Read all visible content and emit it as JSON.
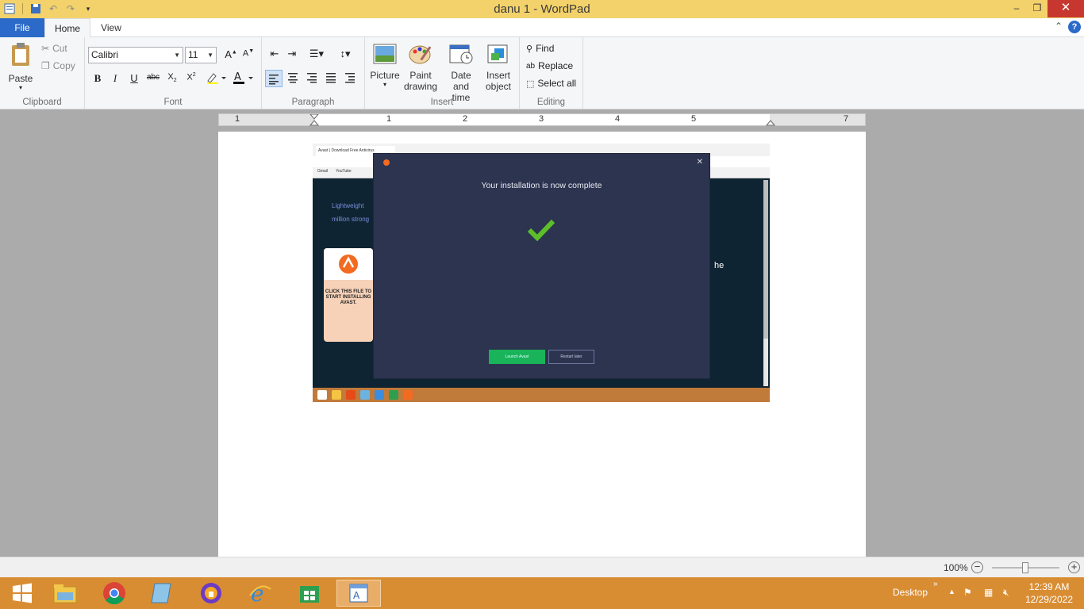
{
  "window": {
    "title": "danu 1 - WordPad",
    "minimize": "–",
    "maximize": "❐",
    "close": "✕"
  },
  "tabs": [
    {
      "label": "File"
    },
    {
      "label": "Home"
    },
    {
      "label": "View"
    }
  ],
  "ribbon": {
    "clipboard": {
      "paste": "Paste",
      "cut": "Cut",
      "copy": "Copy",
      "label": "Clipboard"
    },
    "font": {
      "family": "Calibri",
      "size": "11",
      "label": "Font"
    },
    "paragraph": {
      "label": "Paragraph"
    },
    "insert": {
      "picture": "Picture",
      "paint_1": "Paint",
      "paint_2": "drawing",
      "date_1": "Date and",
      "date_2": "time",
      "object_1": "Insert",
      "object_2": "object",
      "label": "Insert"
    },
    "editing": {
      "find": "Find",
      "replace": "Replace",
      "select_all": "Select all",
      "label": "Editing"
    }
  },
  "ruler": {
    "numbers": [
      "1",
      "1",
      "2",
      "3",
      "4",
      "5",
      "7"
    ]
  },
  "embedded_screenshot": {
    "browser_tab": "Avast | Download Free Antivirus",
    "bookmarks": [
      "Gmail",
      "YouTube"
    ],
    "bg_text_1": "Lightweight",
    "bg_text_2": "million strong",
    "bg_text_3": "he",
    "side_card_text": "CLICK THIS FILE TO START INSTALLING AVAST.",
    "dialog": {
      "heading": "Your installation is now complete",
      "primary_button": "Launch Avast",
      "secondary_button": "Restart later"
    }
  },
  "status": {
    "zoom": "100%",
    "zoom_out": "−",
    "zoom_in": "+"
  },
  "taskbar": {
    "desktop": "Desktop",
    "time": "12:39 AM",
    "date": "12/29/2022"
  },
  "colors": {
    "titlebar": "#f3d26b",
    "file_tab": "#2b6ac8",
    "taskbar": "#d98d33",
    "dialog_bg": "#2d3450",
    "check_green": "#5cbf2a"
  }
}
